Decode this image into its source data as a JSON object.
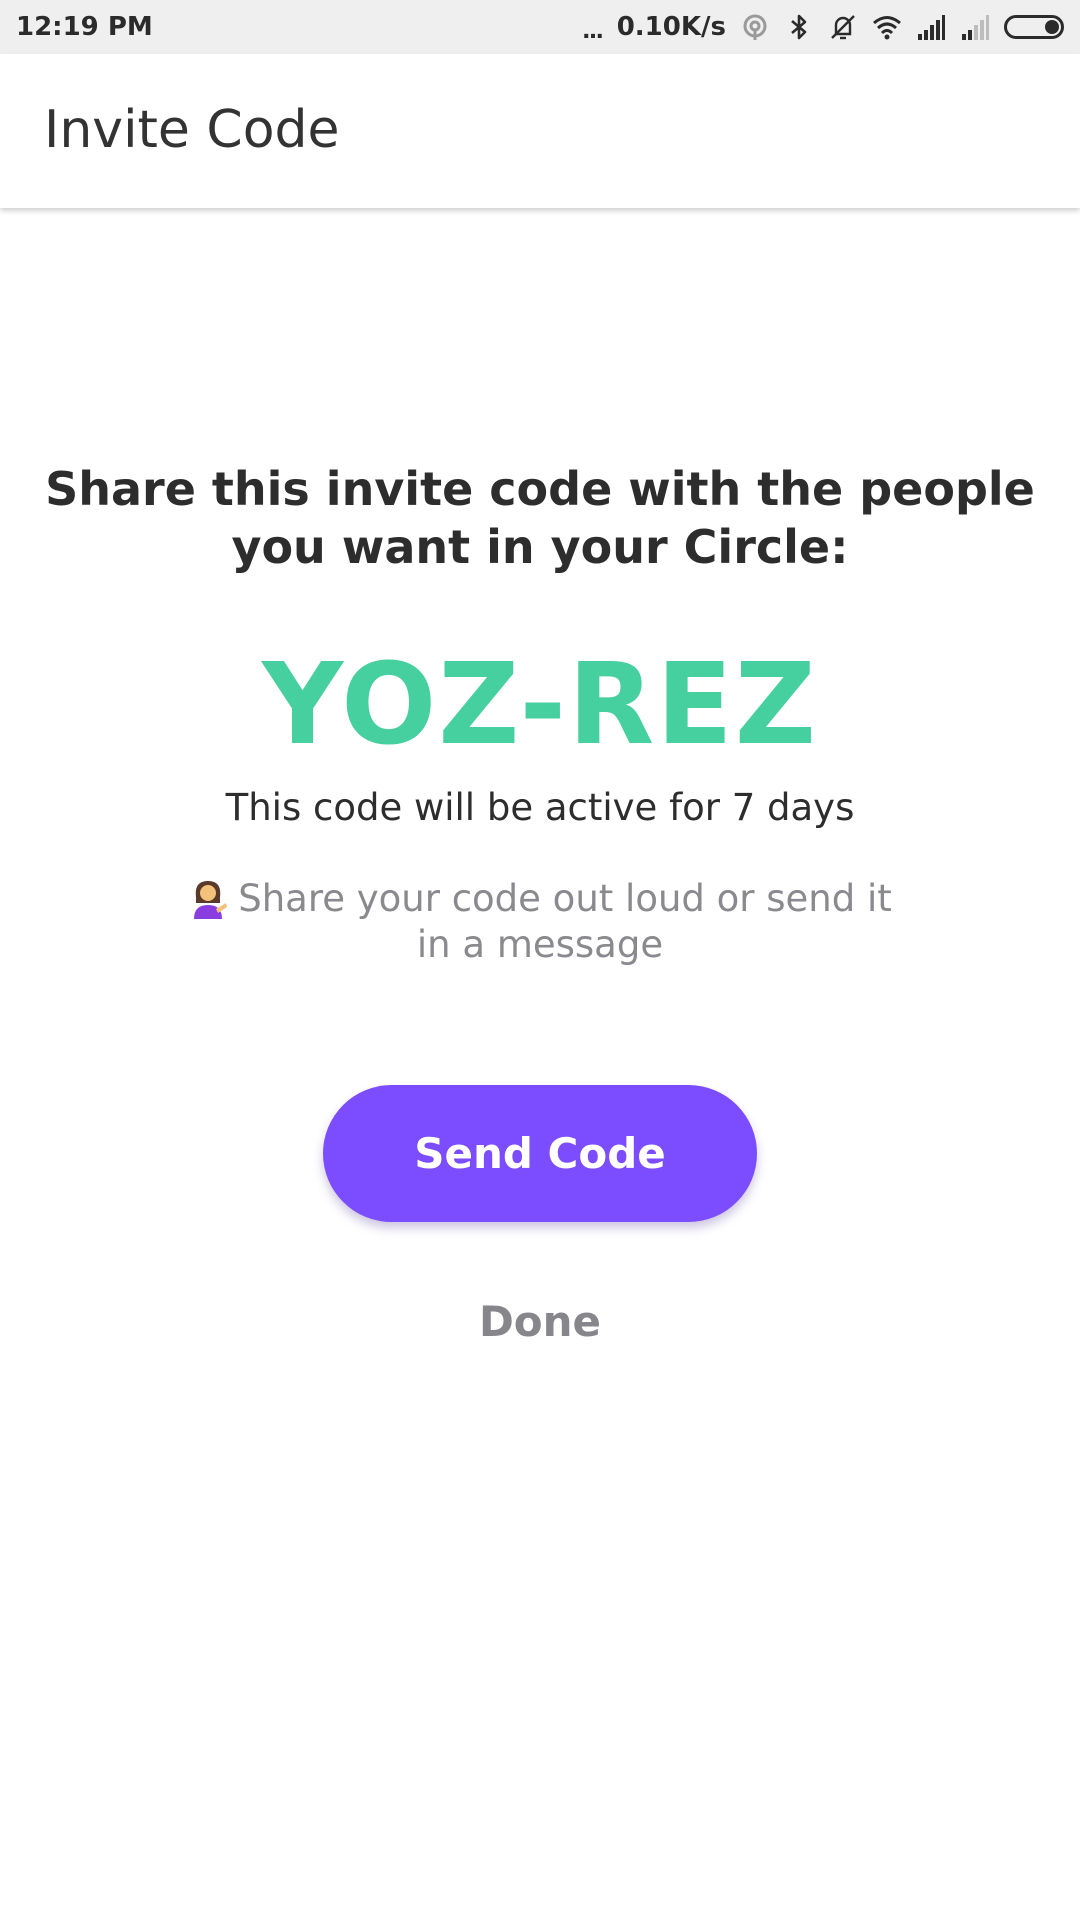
{
  "status_bar": {
    "time": "12:19 PM",
    "dots": "...",
    "network_speed": "0.10K/s",
    "icons": [
      "hotspot-icon",
      "bluetooth-icon",
      "vibrate-off-icon",
      "wifi-icon",
      "signal-icon",
      "signal-weak-icon",
      "battery-icon"
    ]
  },
  "app_bar": {
    "title": "Invite Code"
  },
  "content": {
    "headline_line1": "Share this invite code with the people",
    "headline_line2": "you want in your Circle:",
    "code": "YOZ-REZ",
    "active_note": "This code will be active for 7 days",
    "hint_emoji": "person-tipping-hand-icon",
    "hint_text": "Share your code out loud or send it in a message"
  },
  "actions": {
    "send_label": "Send Code",
    "done_label": "Done"
  },
  "colors": {
    "code": "#46cf9f",
    "primary_button": "#7b4dff",
    "secondary_text": "#8a8a8e"
  }
}
